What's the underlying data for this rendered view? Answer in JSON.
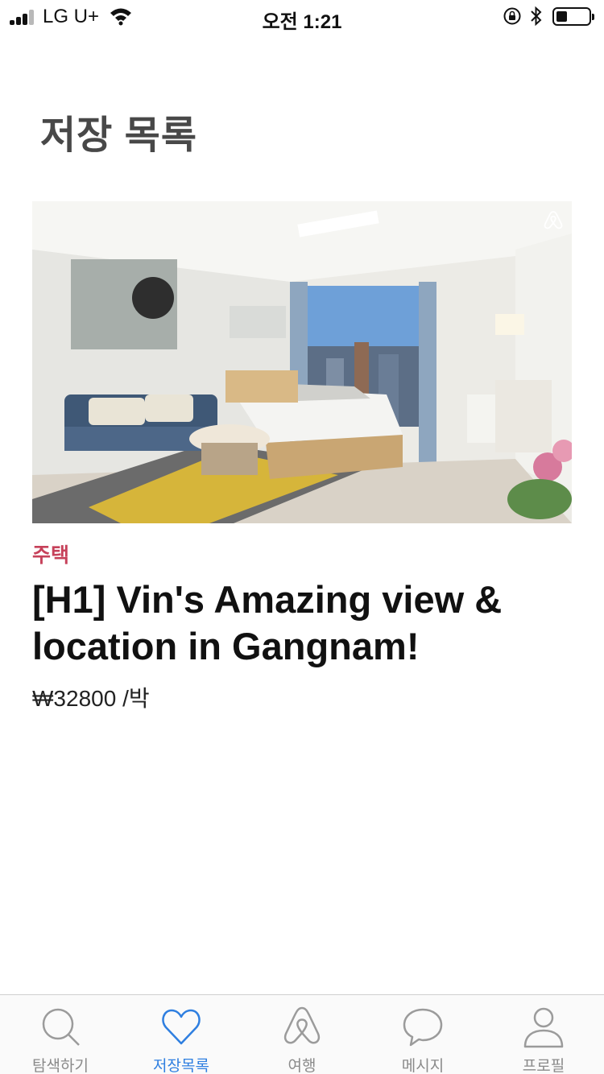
{
  "status_bar": {
    "carrier": "LG U+",
    "time": "오전 1:21"
  },
  "page": {
    "title": "저장 목록"
  },
  "listing": {
    "category": "주택",
    "title": "[H1] Vin's Amazing view & location in Gangnam!",
    "price": "₩32800 /박"
  },
  "tab_bar": {
    "tabs": [
      {
        "label": "탐색하기",
        "icon": "search-icon"
      },
      {
        "label": "저장목록",
        "icon": "heart-icon",
        "active": true
      },
      {
        "label": "여행",
        "icon": "airbnb-logo-icon"
      },
      {
        "label": "메시지",
        "icon": "speech-bubble-icon"
      },
      {
        "label": "프로필",
        "icon": "person-icon"
      }
    ]
  },
  "colors": {
    "accent_active": "#2f7fe0",
    "category": "#c6415a",
    "title_gray": "#484848"
  }
}
